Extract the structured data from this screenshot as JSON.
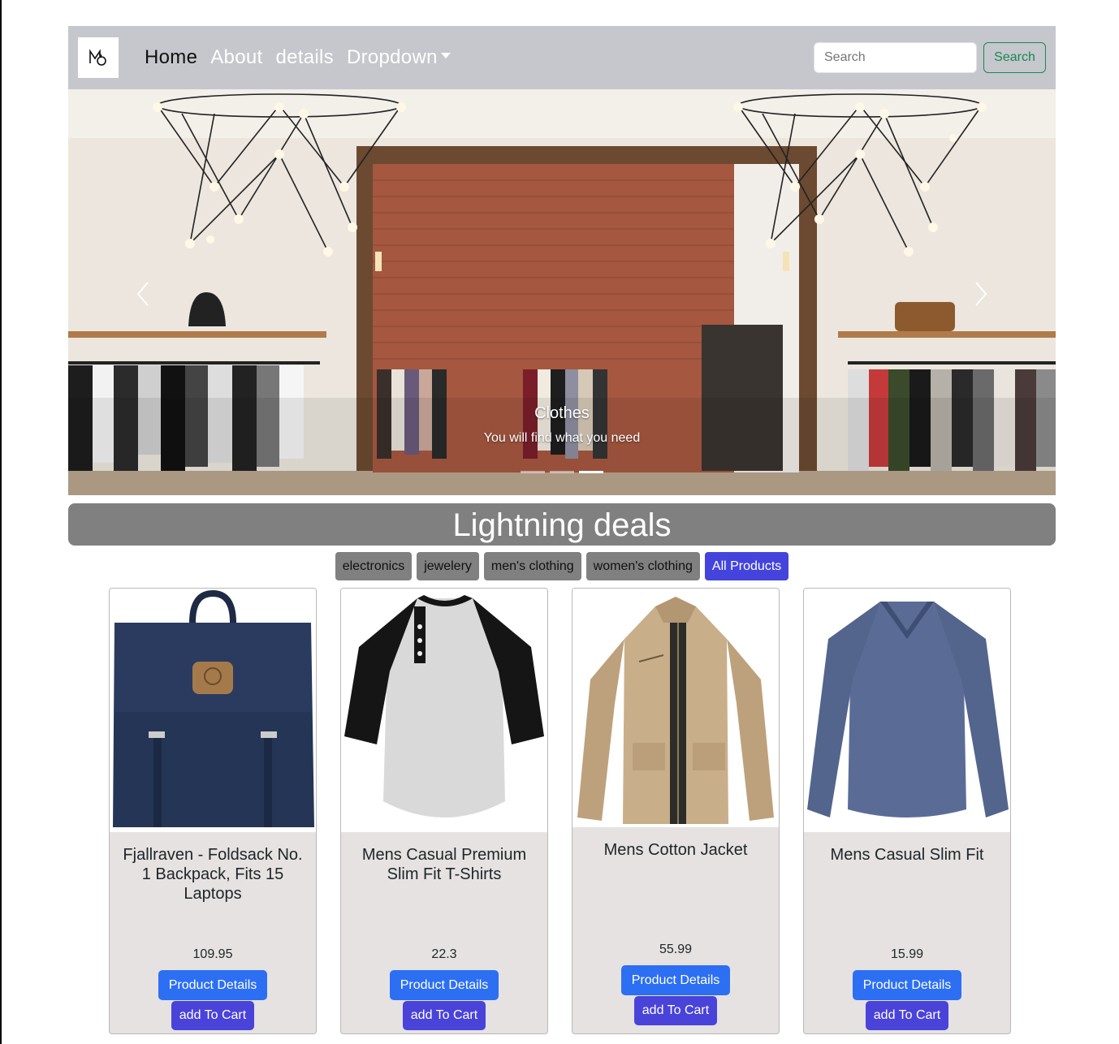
{
  "navbar": {
    "links": [
      {
        "label": "Home",
        "active": true
      },
      {
        "label": "About"
      },
      {
        "label": "details"
      },
      {
        "label": "Dropdown"
      }
    ],
    "search": {
      "placeholder": "Search",
      "button_label": "Search"
    }
  },
  "carousel": {
    "caption_title": "Clothes",
    "caption_text": "You will find what you need",
    "slide_count": 3,
    "active_slide": 3
  },
  "deals": {
    "heading": "Lightning deals",
    "filters": [
      "electronics",
      "jewelery",
      "men's clothing",
      "women's clothing",
      "All Products"
    ],
    "active_filter": "All Products"
  },
  "products": [
    {
      "title": "Fjallraven - Foldsack No. 1 Backpack, Fits 15 Laptops",
      "price": "109.95",
      "image": "backpack"
    },
    {
      "title": "Mens Casual Premium Slim Fit T-Shirts",
      "price": "22.3",
      "image": "raglan-tshirt"
    },
    {
      "title": "Mens Cotton Jacket",
      "price": "55.99",
      "image": "jacket"
    },
    {
      "title": "Mens Casual Slim Fit",
      "price": "15.99",
      "image": "long-sleeve-shirt"
    }
  ],
  "buttons": {
    "details_label": "Product Details",
    "cart_label": "add To Cart"
  },
  "colors": {
    "navbar": "#c5c7cc",
    "deals_banner": "#808080",
    "active_filter": "#4444dd",
    "details_button": "#2d6ff3",
    "cart_button": "#4a43d9",
    "search_outline": "#198754"
  }
}
